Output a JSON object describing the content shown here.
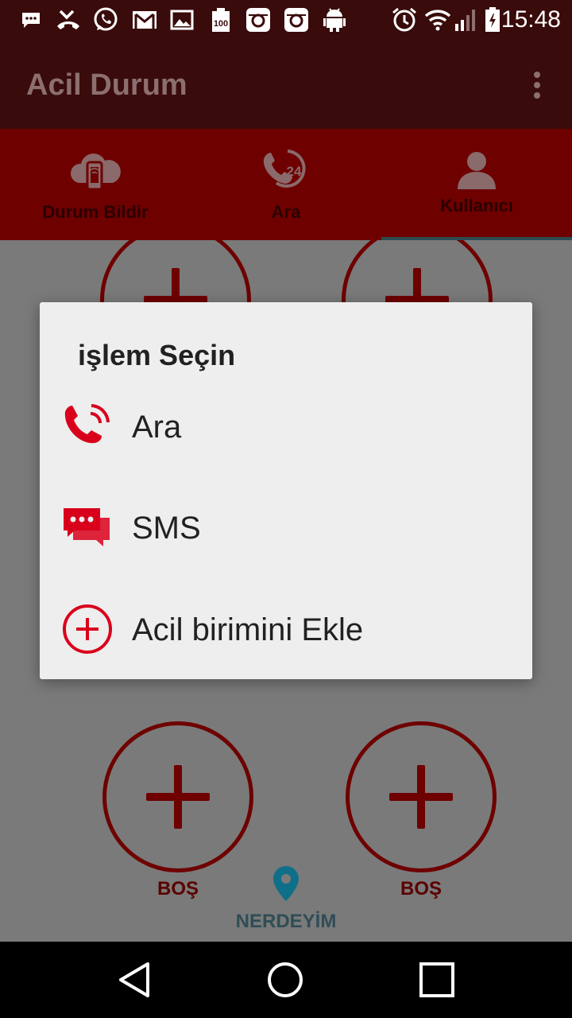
{
  "status_bar": {
    "time": "15:48",
    "icons": [
      "message-icon",
      "missed-call-icon",
      "whatsapp-icon",
      "gmail-icon",
      "gallery-icon",
      "battery-saver-icon",
      "instagram-icon",
      "instagram-icon",
      "android-icon",
      "alarm-icon",
      "wifi-icon",
      "signal-icon",
      "battery-icon"
    ]
  },
  "app_bar": {
    "title": "Acil Durum",
    "menu_icon": "more-vert-icon"
  },
  "tabs": [
    {
      "label": "Durum Bildir",
      "icon": "cloud-phone-icon"
    },
    {
      "label": "Ara",
      "icon": "phone-24-icon"
    },
    {
      "label": "Kullanıcı",
      "icon": "user-icon",
      "selected": true
    }
  ],
  "content": {
    "slot_left_label": "BOŞ",
    "slot_right_label": "BOŞ",
    "location_label": "NERDEYİM",
    "location_icon": "location-pin-icon"
  },
  "dialog": {
    "title": "işlem Seçin",
    "items": [
      {
        "label": "Ara",
        "icon": "phone-call-icon"
      },
      {
        "label": "SMS",
        "icon": "chat-bubbles-icon"
      },
      {
        "label": "Acil birimini Ekle",
        "icon": "add-circle-icon"
      }
    ]
  },
  "colors": {
    "app_bar": "#3a0b0b",
    "tab_bar": "#6e0000",
    "accent_red": "#d9001b",
    "tab_indicator": "#2d4c50",
    "location_blue": "#0f8fb0"
  },
  "nav_bar": {
    "buttons": [
      "back-icon",
      "home-icon",
      "recents-icon"
    ]
  }
}
